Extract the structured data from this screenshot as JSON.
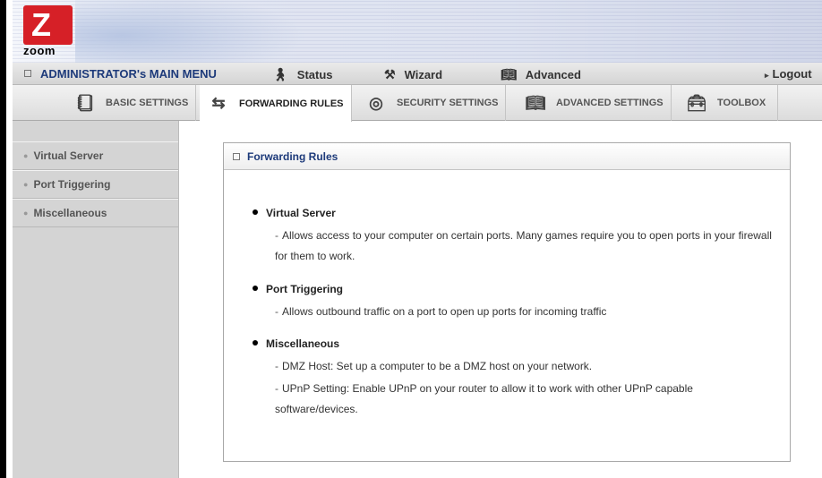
{
  "logo": {
    "word": "zoom",
    "mark": "Z"
  },
  "menubar": {
    "main_menu": "ADMINISTRATOR's MAIN MENU",
    "status": "Status",
    "wizard": "Wizard",
    "advanced": "Advanced",
    "logout": "Logout"
  },
  "tabs": [
    {
      "label": "BASIC SETTINGS",
      "icon": "notebook-icon"
    },
    {
      "label": "FORWARDING RULES",
      "icon": "arrows-icon"
    },
    {
      "label": "SECURITY SETTINGS",
      "icon": "shield-icon"
    },
    {
      "label": "ADVANCED SETTINGS",
      "icon": "book-icon"
    },
    {
      "label": "TOOLBOX",
      "icon": "toolbox-icon"
    }
  ],
  "active_tab": "FORWARDING RULES",
  "sidebar": {
    "items": [
      {
        "label": "Virtual Server"
      },
      {
        "label": "Port Triggering"
      },
      {
        "label": "Miscellaneous"
      }
    ]
  },
  "panel": {
    "title": "Forwarding Rules",
    "sections": [
      {
        "title": "Virtual Server",
        "lines": [
          "Allows access to your computer on certain ports. Many games require you to open ports in your firewall for them to work."
        ]
      },
      {
        "title": "Port Triggering",
        "lines": [
          "Allows outbound traffic on a port to open up ports for incoming traffic"
        ]
      },
      {
        "title": "Miscellaneous",
        "lines": [
          "DMZ Host: Set up a computer to be a DMZ host on your network.",
          "UPnP Setting: Enable UPnP on your router to allow it to work with other UPnP capable software/devices."
        ]
      }
    ]
  },
  "colors": {
    "menu_text": "#1d3a7a",
    "logo_red": "#d62027",
    "sidebar_bg": "#d4d4d4"
  }
}
